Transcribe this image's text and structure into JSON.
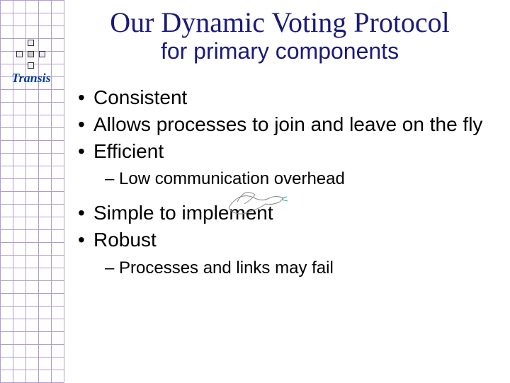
{
  "logo": {
    "text": "Transis"
  },
  "title": "Our Dynamic Voting Protocol",
  "subtitle": "for primary components",
  "bullets": [
    {
      "text": "Consistent"
    },
    {
      "text": "Allows processes to join and leave on the fly"
    },
    {
      "text": "Efficient",
      "sub": [
        "Low communication overhead"
      ]
    },
    {
      "text": "Simple to implement"
    },
    {
      "text": "Robust",
      "sub": [
        "Processes and links may fail"
      ]
    }
  ]
}
